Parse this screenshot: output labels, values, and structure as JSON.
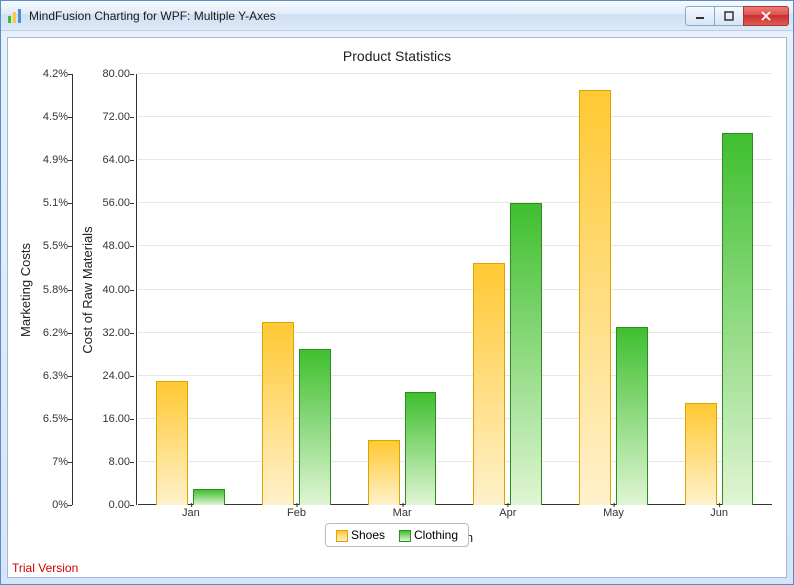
{
  "window": {
    "title": "MindFusion Charting for WPF: Multiple Y-Axes"
  },
  "chart_data": {
    "type": "bar",
    "title": "Product Statistics",
    "xlabel": "Month",
    "y1label": "Marketing Costs",
    "y2label": "Cost of Raw Materials",
    "categories": [
      "Jan",
      "Feb",
      "Mar",
      "Apr",
      "May",
      "Jun"
    ],
    "y1_ticks": [
      "0%",
      "7%",
      "6.5%",
      "6.3%",
      "6.2%",
      "5.8%",
      "5.5%",
      "5.1%",
      "4.9%",
      "4.5%",
      "4.2%"
    ],
    "y2_ticks": [
      "0.00",
      "8.00",
      "16.00",
      "24.00",
      "32.00",
      "40.00",
      "48.00",
      "56.00",
      "64.00",
      "72.00",
      "80.00"
    ],
    "y2_range": [
      0,
      80
    ],
    "series": [
      {
        "name": "Shoes",
        "values": [
          23,
          34,
          12,
          45,
          77,
          19
        ]
      },
      {
        "name": "Clothing",
        "values": [
          3,
          29,
          21,
          56,
          33,
          69
        ]
      }
    ],
    "legend": [
      "Shoes",
      "Clothing"
    ]
  },
  "footer": {
    "trial": "Trial Version"
  }
}
